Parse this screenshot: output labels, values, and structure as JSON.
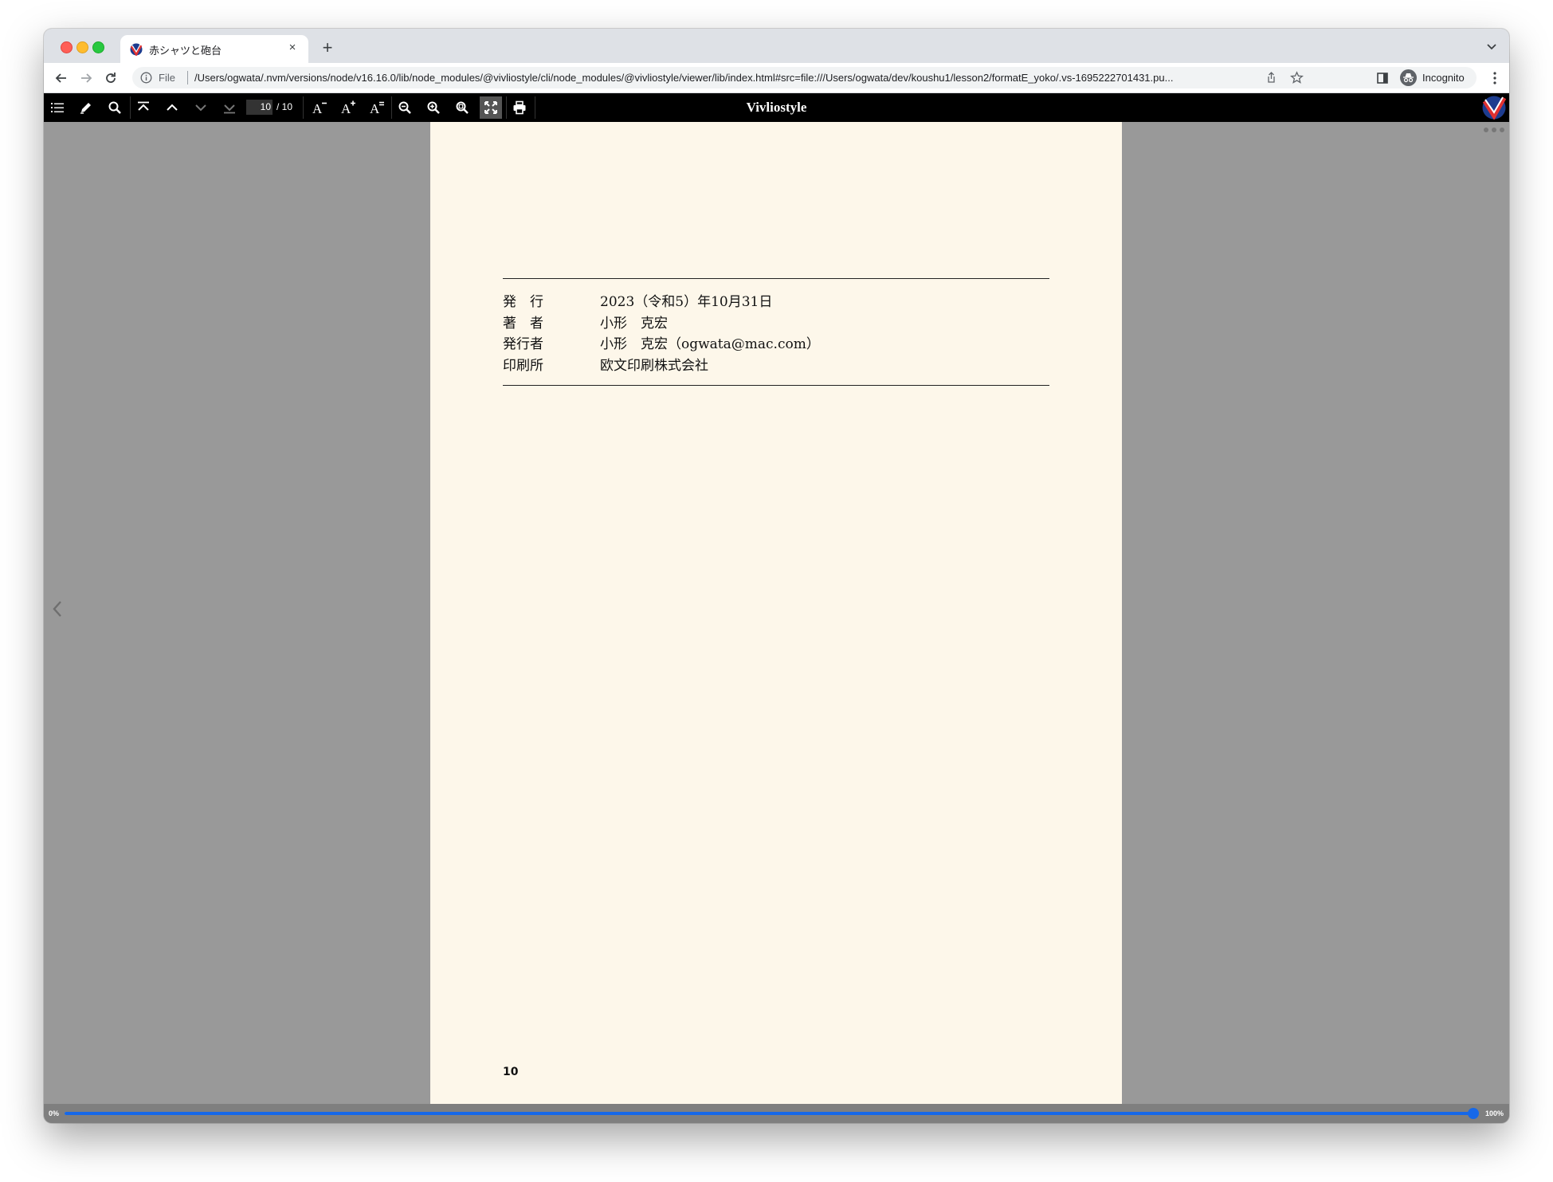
{
  "browser": {
    "tab": {
      "title": "赤シャツと砲台",
      "close_glyph": "×",
      "favicon": "vivliostyle-favicon"
    },
    "new_tab_glyph": "+",
    "omnibox": {
      "scheme_label": "File",
      "url": "/Users/ogwata/.nvm/versions/node/v16.16.0/lib/node_modules/@vivliostyle/cli/node_modules/@vivliostyle/viewer/lib/index.html#src=file:///Users/ogwata/dev/koushu1/lesson2/formatE_yoko/.vs-1695222701431.pu..."
    },
    "incognito_label": "Incognito"
  },
  "viewer": {
    "title": "Vivliostyle",
    "page_current": "10",
    "page_total": "/ 10",
    "buttons": [
      "toc-icon",
      "marker-icon",
      "search-icon",
      "first-page-icon",
      "prev-page-icon",
      "next-page-icon",
      "last-page-icon",
      "font-size-decrease-icon",
      "font-size-increase-icon",
      "font-size-reset-icon",
      "zoom-out-icon",
      "zoom-in-icon",
      "zoom-actual-icon",
      "fit-page-icon",
      "print-icon"
    ]
  },
  "document": {
    "colophon": [
      {
        "label": "発　行",
        "value": "2023（令和5）年10月31日"
      },
      {
        "label": "著　者",
        "value": "小形　克宏"
      },
      {
        "label": "発行者",
        "value": "小形　克宏（ogwata@mac.com）"
      },
      {
        "label": "印刷所",
        "value": "欧文印刷株式会社"
      }
    ],
    "page_number": "10"
  },
  "progress": {
    "min_label": "0%",
    "max_label": "100%",
    "value": 1.0,
    "color": "#1668e8"
  },
  "colors": {
    "page_background": "#fdf7ea",
    "viewer_bar": "#000000",
    "viewport": "#999999"
  }
}
